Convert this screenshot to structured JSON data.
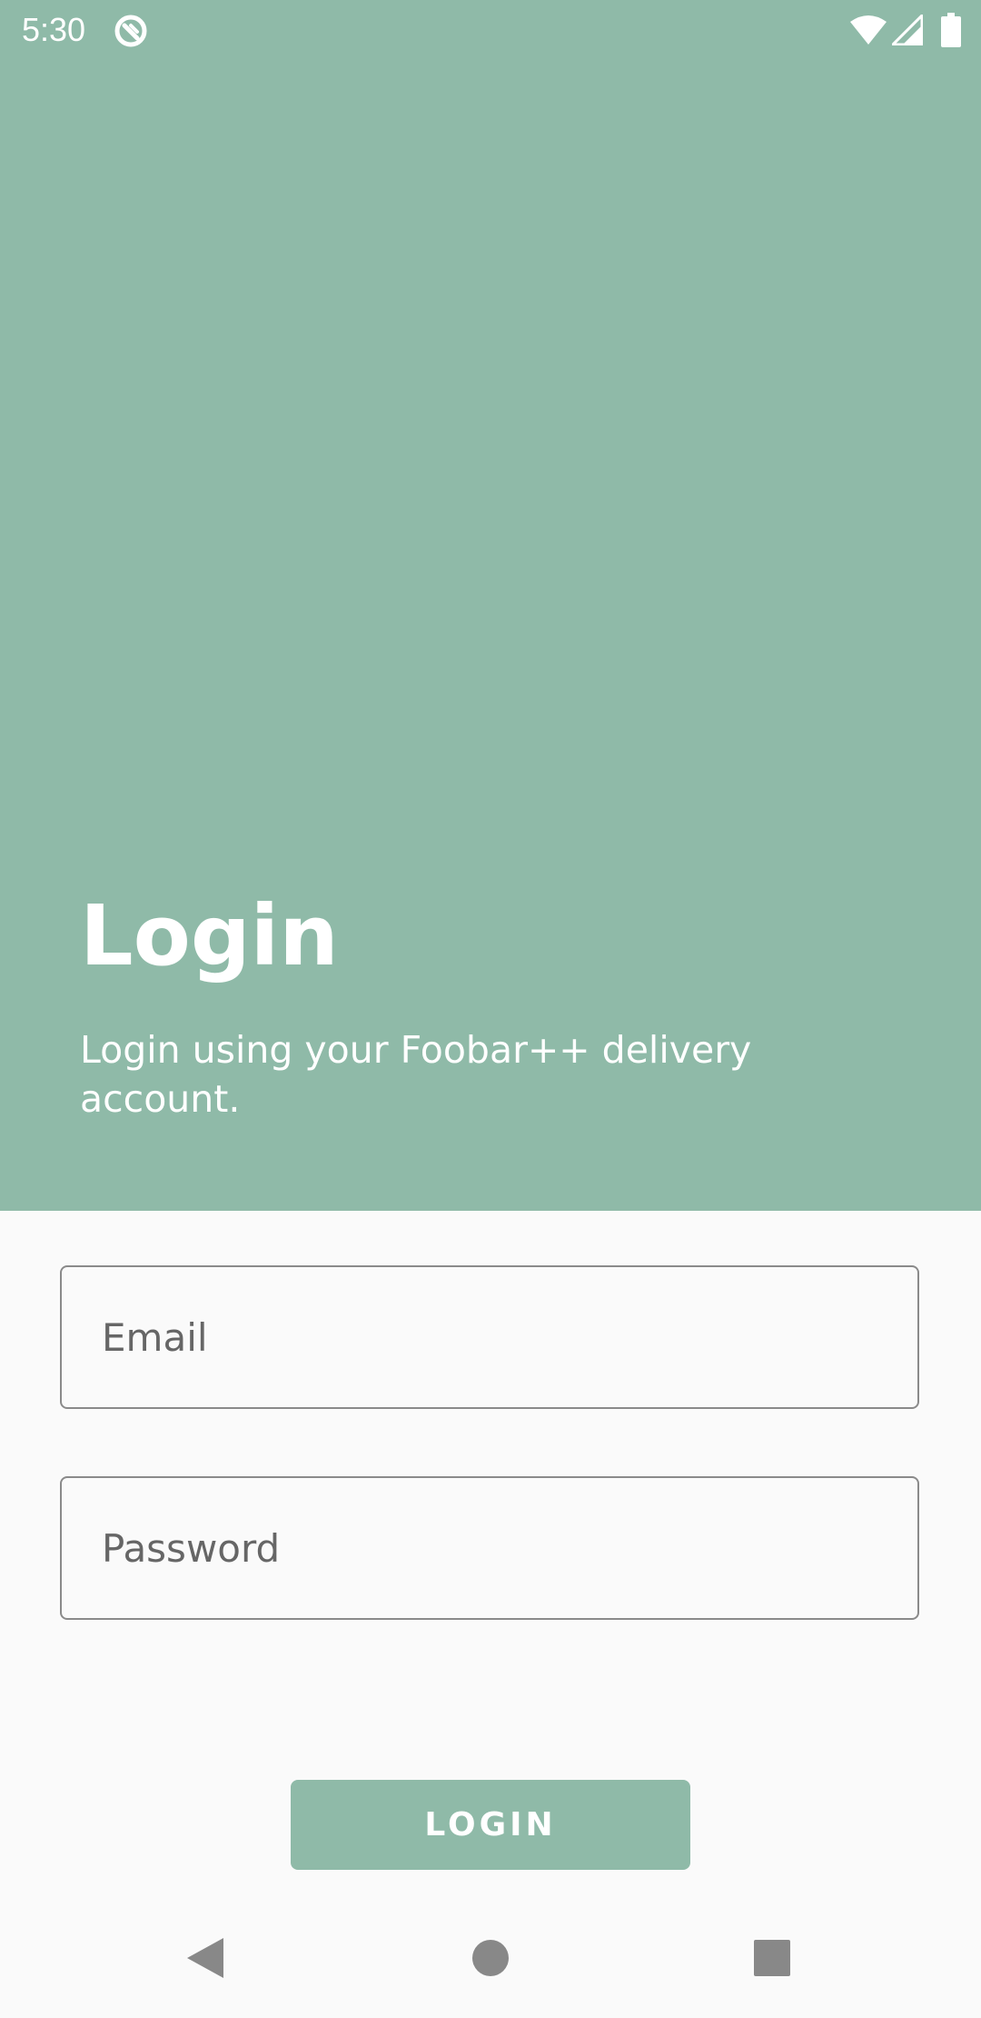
{
  "status_bar": {
    "time": "5:30",
    "icons": [
      "notification-app-icon",
      "wifi-icon",
      "cell-signal-icon",
      "battery-icon"
    ]
  },
  "header": {
    "title": "Login",
    "subtitle": "Login using your Foobar++ delivery account."
  },
  "form": {
    "email_placeholder": "Email",
    "email_value": "",
    "password_placeholder": "Password",
    "password_value": "",
    "login_label": "LOGIN"
  },
  "nav_bar": {
    "icons": [
      "back-icon",
      "home-icon",
      "recents-icon"
    ]
  },
  "colors": {
    "accent": "#8fbaa8",
    "background": "#fafafa",
    "field_border": "#8a8a8a",
    "placeholder_text": "#666666",
    "nav_icon": "#888888"
  }
}
